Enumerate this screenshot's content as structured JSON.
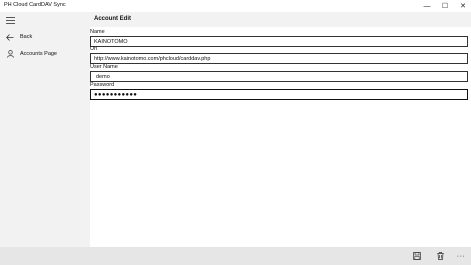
{
  "window": {
    "title": "PH Cloud CardDAV Sync",
    "minimize_glyph": "—",
    "maximize_glyph": "☐",
    "close_glyph": "✕"
  },
  "sidebar": {
    "menu_icon": "hamburger-icon",
    "items": [
      {
        "label": "Back",
        "icon": "back-arrow-icon"
      },
      {
        "label": "Accounts Page",
        "icon": "person-icon"
      }
    ]
  },
  "header": {
    "title": "Account Edit"
  },
  "form": {
    "name": {
      "label": "Name",
      "value": "KAINOTOMO"
    },
    "url": {
      "label": "Url",
      "value": "http://www.kainotomo.com/phcloud/carddav.php"
    },
    "username": {
      "label": "User Name",
      "value": "demo"
    },
    "password": {
      "label": "Password",
      "value": "●●●●●●●●●●●"
    }
  },
  "bottombar": {
    "save_icon": "save-icon",
    "delete_icon": "trash-icon",
    "more_label": "···"
  },
  "colors": {
    "sidebar_bg": "#f2f2f2",
    "bottombar_bg": "#e6e6e6",
    "input_border": "#333333"
  }
}
